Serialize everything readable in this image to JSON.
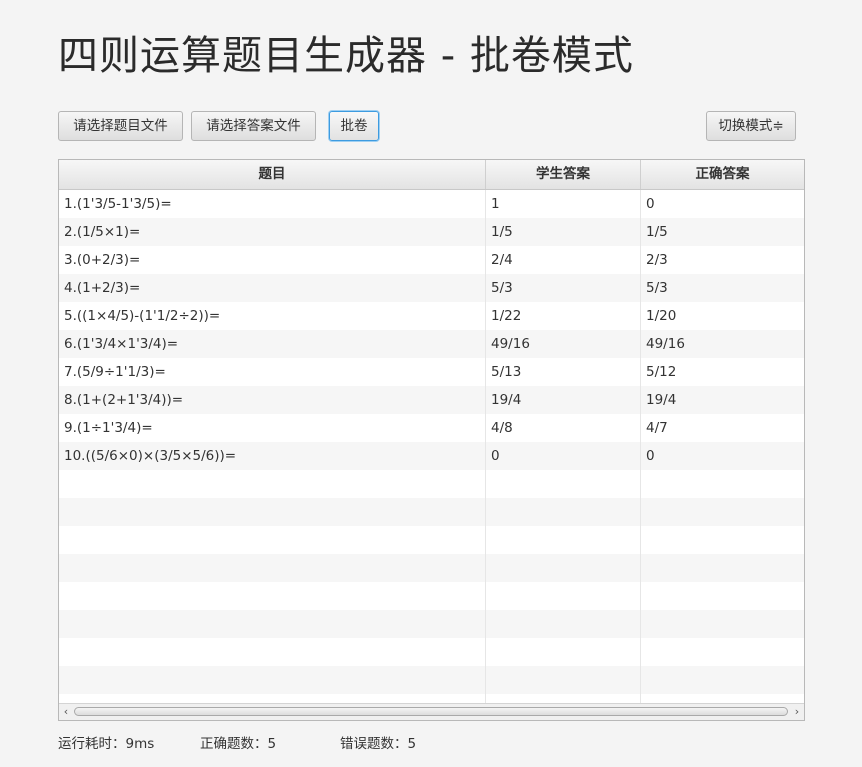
{
  "header": {
    "title": "四则运算题目生成器 - 批卷模式"
  },
  "toolbar": {
    "choose_question_file": "请选择题目文件",
    "choose_answer_file": "请选择答案文件",
    "grade": "批卷",
    "switch_mode": "切换模式≑"
  },
  "table": {
    "columns": [
      "题目",
      "学生答案",
      "正确答案"
    ],
    "rows": [
      {
        "question": "1.(1'3/5-1'3/5)=",
        "student": "1",
        "correct": "0"
      },
      {
        "question": "2.(1/5×1)=",
        "student": "1/5",
        "correct": "1/5"
      },
      {
        "question": "3.(0+2/3)=",
        "student": "2/4",
        "correct": "2/3"
      },
      {
        "question": "4.(1+2/3)=",
        "student": "5/3",
        "correct": "5/3"
      },
      {
        "question": "5.((1×4/5)-(1'1/2÷2))=",
        "student": "1/22",
        "correct": "1/20"
      },
      {
        "question": "6.(1'3/4×1'3/4)=",
        "student": "49/16",
        "correct": "49/16"
      },
      {
        "question": "7.(5/9÷1'1/3)=",
        "student": "5/13",
        "correct": "5/12"
      },
      {
        "question": "8.(1+(2+1'3/4))=",
        "student": "19/4",
        "correct": "19/4"
      },
      {
        "question": "9.(1÷1'3/4)=",
        "student": "4/8",
        "correct": "4/7"
      },
      {
        "question": "10.((5/6×0)×(3/5×5/6))=",
        "student": "0",
        "correct": "0"
      }
    ]
  },
  "status": {
    "runtime": "运行耗时：9ms",
    "correct_count": "正确题数：5",
    "wrong_count": "错误题数：5"
  },
  "icons": {
    "scroll_left": "chevron-left-icon",
    "scroll_right": "chevron-right-icon"
  }
}
